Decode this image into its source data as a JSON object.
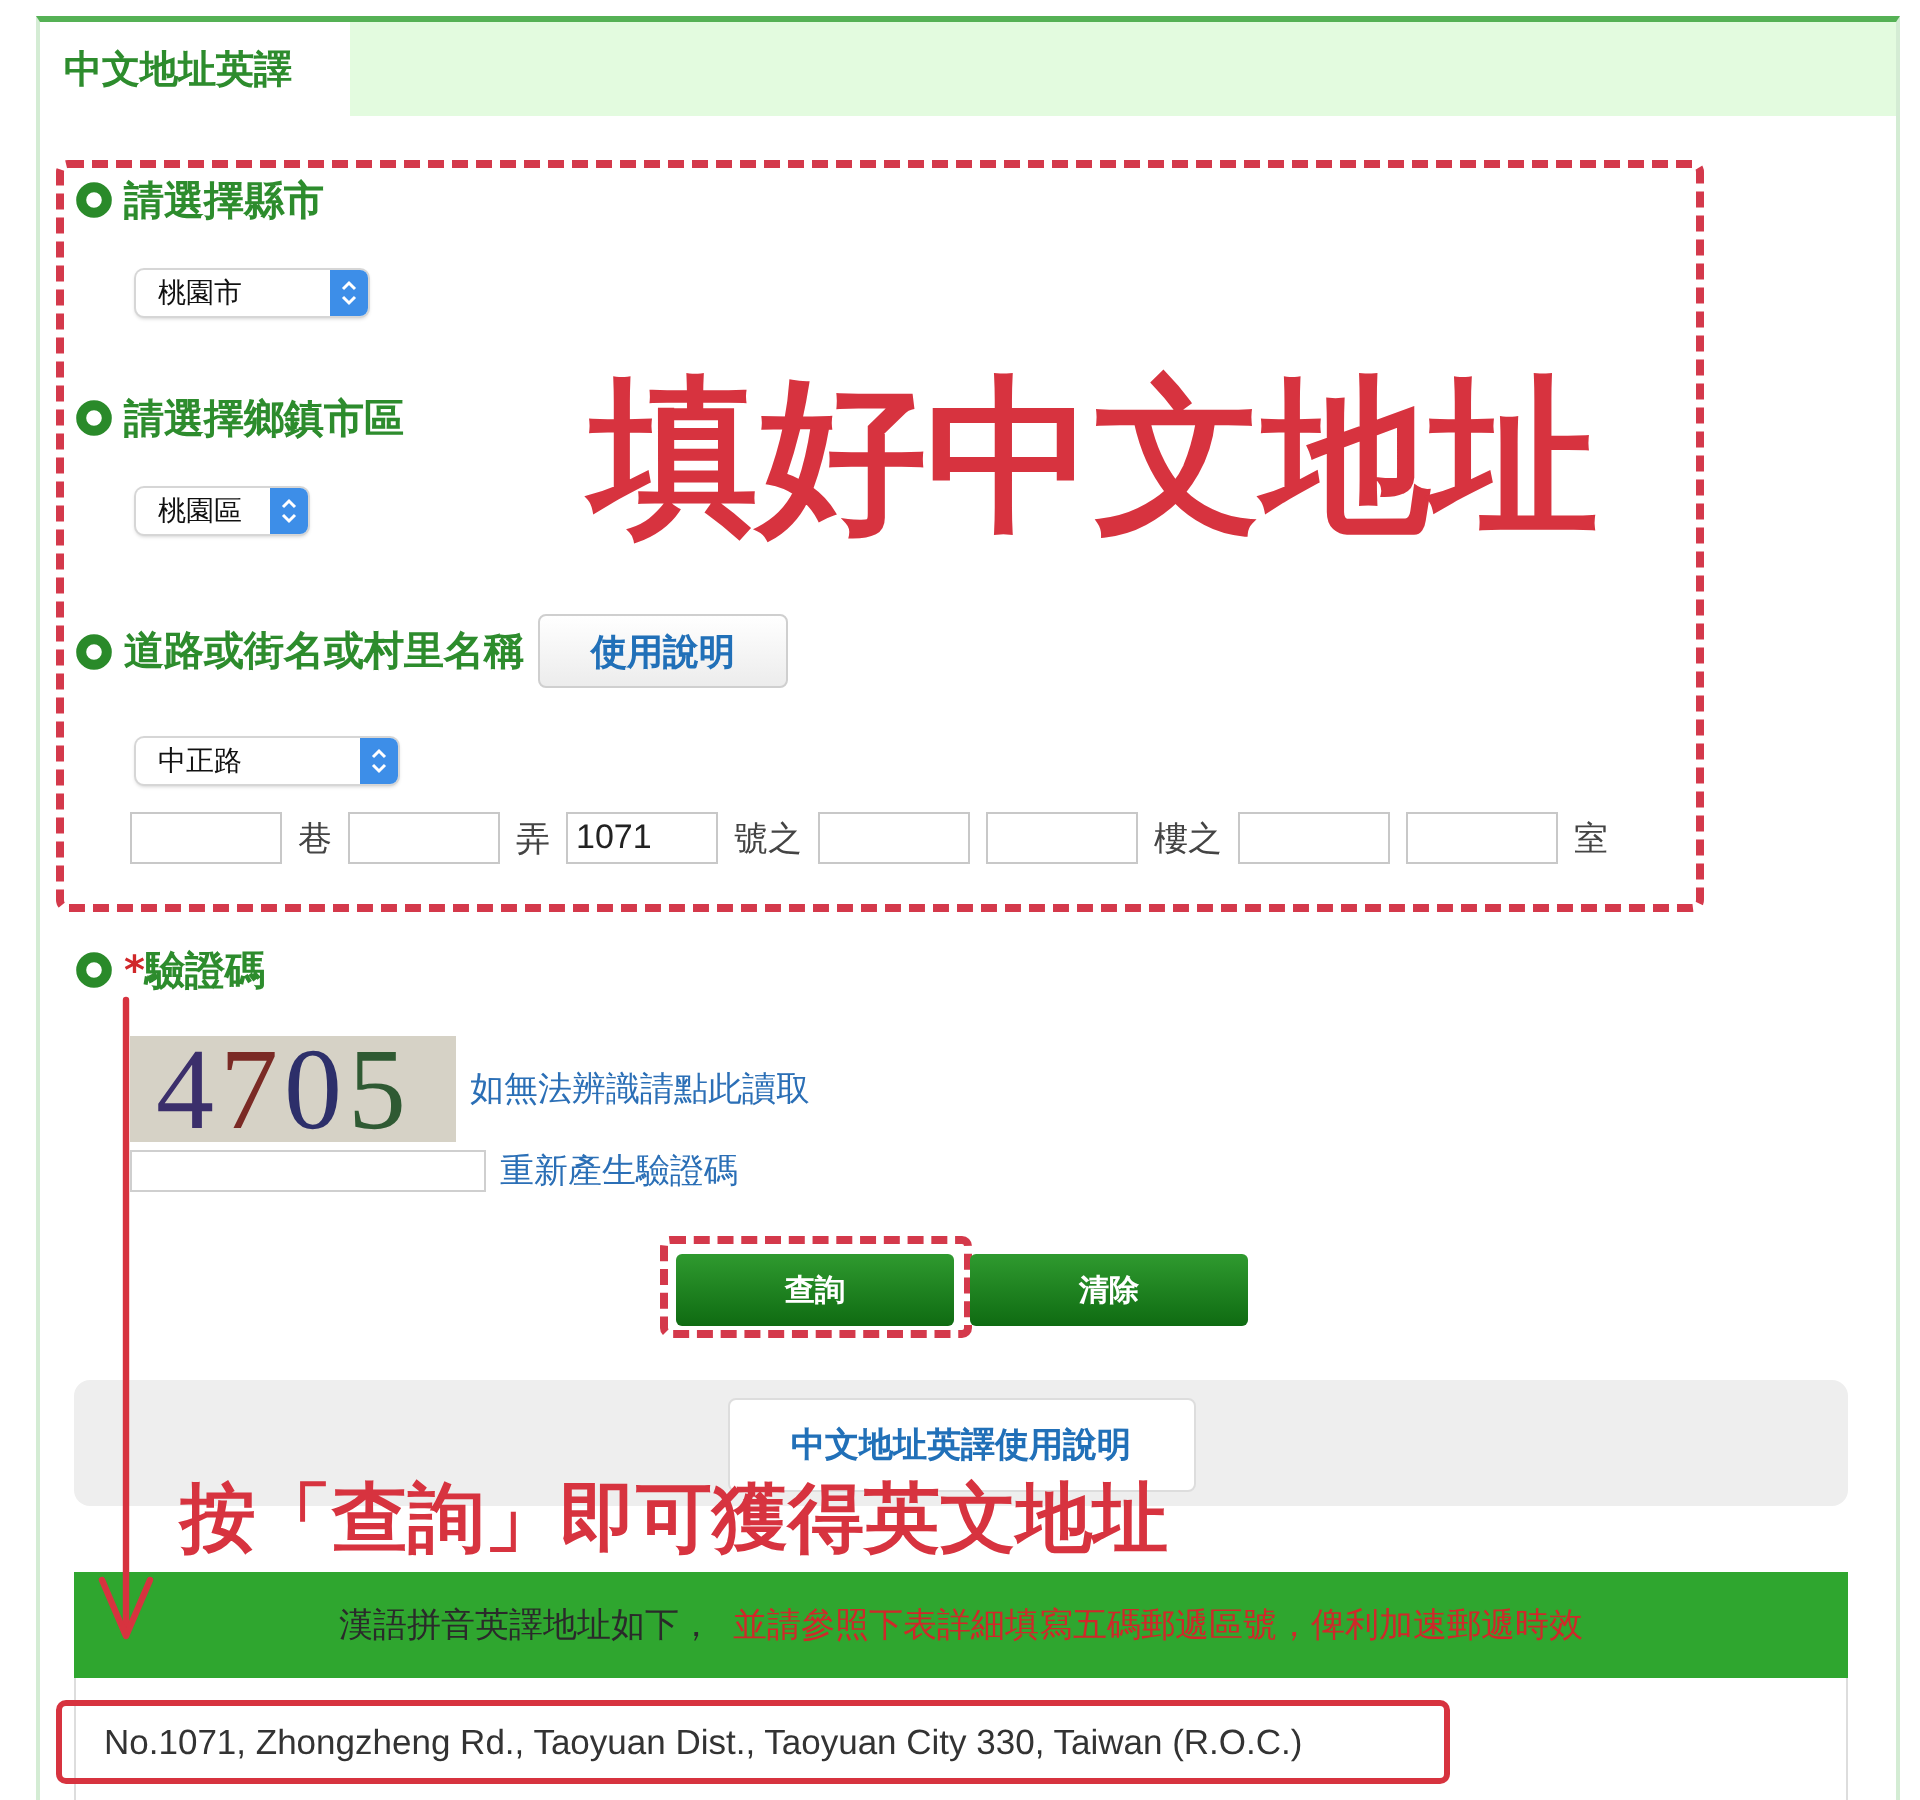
{
  "tabs": [
    {
      "label": "中文地址英譯",
      "selected": true
    }
  ],
  "address_form": {
    "fields": [
      {
        "kind": "select",
        "label": "請選擇縣市",
        "value": "桃園市"
      },
      {
        "kind": "select",
        "label": "請選擇鄉鎮市區",
        "value": "桃園區"
      },
      {
        "kind": "street",
        "label": "道路或街名或村里名稱",
        "help_button": "使用說明",
        "value": "中正路",
        "parts": [
          {
            "kind": "input"
          },
          {
            "kind": "unit",
            "text": "巷"
          },
          {
            "kind": "input"
          },
          {
            "kind": "unit",
            "text": "弄"
          },
          {
            "kind": "input",
            "value": "1071"
          },
          {
            "kind": "unit",
            "text": "號之"
          },
          {
            "kind": "input"
          },
          {
            "kind": "input"
          },
          {
            "kind": "unit",
            "text": "樓之"
          },
          {
            "kind": "input"
          },
          {
            "kind": "input"
          },
          {
            "kind": "unit",
            "text": "室"
          }
        ]
      }
    ]
  },
  "captcha": {
    "required_mark": "*",
    "label": "驗證碼",
    "digits": [
      {
        "text": "4",
        "color": "#3b2f6b"
      },
      {
        "text": "7",
        "color": "#7a2a25"
      },
      {
        "text": "0",
        "color": "#2d2f6a"
      },
      {
        "text": "5",
        "color": "#2f5a33"
      }
    ],
    "reload_link": "如無法辨識請點此讀取",
    "regenerate_link": "重新產生驗證碼"
  },
  "buttons": [
    {
      "label": "查詢",
      "highlighted": true
    },
    {
      "label": "清除",
      "highlighted": false
    }
  ],
  "help_button": "中文地址英譯使用說明",
  "result": {
    "heading": "漢語拼音英譯地址如下，",
    "note": "並請參照下表詳細填寫五碼郵遞區號，俾利加速郵遞時效",
    "address": "No.1071, Zhongzheng Rd., Taoyuan Dist., Taoyuan City 330, Taiwan (R.O.C.)",
    "highlighted": true
  },
  "annotations": [
    {
      "text": "填好中文地址"
    },
    {
      "text": "按「查詢」即可獲得英文地址"
    }
  ]
}
